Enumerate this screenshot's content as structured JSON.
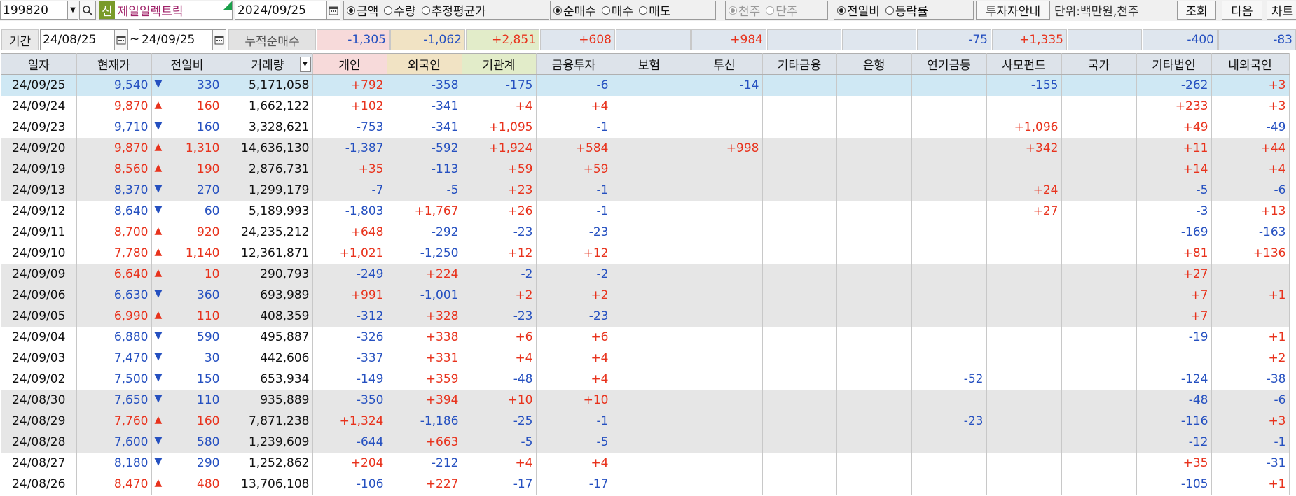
{
  "toolbar": {
    "code": "199820",
    "new_tag": "신",
    "company": "제일일렉트릭",
    "date": "2024/09/25",
    "radio_group1": [
      {
        "label": "금액",
        "on": true
      },
      {
        "label": "수량",
        "on": false
      },
      {
        "label": "추정평균가",
        "on": false
      }
    ],
    "radio_group2": [
      {
        "label": "순매수",
        "on": true
      },
      {
        "label": "매수",
        "on": false
      },
      {
        "label": "매도",
        "on": false
      }
    ],
    "radio_group3": [
      {
        "label": "천주",
        "on": true
      },
      {
        "label": "단주",
        "on": false
      }
    ],
    "radio_group4": [
      {
        "label": "전일비",
        "on": true
      },
      {
        "label": "등락률",
        "on": false
      }
    ],
    "investor_guide": "투자자안내",
    "unit": "단위:백만원,천주",
    "query": "조회",
    "next": "다음",
    "chart": "차트"
  },
  "period": {
    "label": "기간",
    "from": "24/08/25",
    "sep": "~",
    "to": "24/09/25",
    "cumulative_label": "누적순매수"
  },
  "summary": {
    "individual": "-1,305",
    "foreign": "-1,062",
    "institution": "+2,851",
    "finance": "+608",
    "insurance": "",
    "trust": "+984",
    "other_finance": "",
    "bank": "",
    "pension": "-75",
    "private_fund": "+1,335",
    "nation": "",
    "other_corp": "-400",
    "domestic_foreign": "-83"
  },
  "colors": {
    "up": "#e8321c",
    "down": "#2550c0",
    "header_bg": "#dde3ea",
    "selected_row": "#cfe8f4"
  },
  "columns": [
    "일자",
    "현재가",
    "전일비",
    "거래량",
    "개인",
    "외국인",
    "기관계",
    "금융투자",
    "보험",
    "투신",
    "기타금융",
    "은행",
    "연기금등",
    "사모펀드",
    "국가",
    "기타법인",
    "내외국인"
  ],
  "rows": [
    {
      "date": "24/09/25",
      "price": "9,540",
      "dir": "down",
      "chg": "330",
      "vol": "5,171,058",
      "ind": "+792",
      "frn": "-358",
      "inst": "-175",
      "fin": "-6",
      "ins": "",
      "trust": "-14",
      "ofin": "",
      "bank": "",
      "pen": "",
      "pf": "-155",
      "nat": "",
      "ocorp": "-262",
      "dfrn": "+3",
      "style": "sel"
    },
    {
      "date": "24/09/24",
      "price": "9,870",
      "dir": "up",
      "chg": "160",
      "vol": "1,662,122",
      "ind": "+102",
      "frn": "-341",
      "inst": "+4",
      "fin": "+4",
      "ins": "",
      "trust": "",
      "ofin": "",
      "bank": "",
      "pen": "",
      "pf": "",
      "nat": "",
      "ocorp": "+233",
      "dfrn": "+3",
      "style": ""
    },
    {
      "date": "24/09/23",
      "price": "9,710",
      "dir": "down",
      "chg": "160",
      "vol": "3,328,621",
      "ind": "-753",
      "frn": "-341",
      "inst": "+1,095",
      "fin": "-1",
      "ins": "",
      "trust": "",
      "ofin": "",
      "bank": "",
      "pen": "",
      "pf": "+1,096",
      "nat": "",
      "ocorp": "+49",
      "dfrn": "-49",
      "style": ""
    },
    {
      "date": "24/09/20",
      "price": "9,870",
      "dir": "up",
      "chg": "1,310",
      "vol": "14,636,130",
      "ind": "-1,387",
      "frn": "-592",
      "inst": "+1,924",
      "fin": "+584",
      "ins": "",
      "trust": "+998",
      "ofin": "",
      "bank": "",
      "pen": "",
      "pf": "+342",
      "nat": "",
      "ocorp": "+11",
      "dfrn": "+44",
      "style": "grey"
    },
    {
      "date": "24/09/19",
      "price": "8,560",
      "dir": "up",
      "chg": "190",
      "vol": "2,876,731",
      "ind": "+35",
      "frn": "-113",
      "inst": "+59",
      "fin": "+59",
      "ins": "",
      "trust": "",
      "ofin": "",
      "bank": "",
      "pen": "",
      "pf": "",
      "nat": "",
      "ocorp": "+14",
      "dfrn": "+4",
      "style": "grey"
    },
    {
      "date": "24/09/13",
      "price": "8,370",
      "dir": "down",
      "chg": "270",
      "vol": "1,299,179",
      "ind": "-7",
      "frn": "-5",
      "inst": "+23",
      "fin": "-1",
      "ins": "",
      "trust": "",
      "ofin": "",
      "bank": "",
      "pen": "",
      "pf": "+24",
      "nat": "",
      "ocorp": "-5",
      "dfrn": "-6",
      "style": "grey"
    },
    {
      "date": "24/09/12",
      "price": "8,640",
      "dir": "down",
      "chg": "60",
      "vol": "5,189,993",
      "ind": "-1,803",
      "frn": "+1,767",
      "inst": "+26",
      "fin": "-1",
      "ins": "",
      "trust": "",
      "ofin": "",
      "bank": "",
      "pen": "",
      "pf": "+27",
      "nat": "",
      "ocorp": "-3",
      "dfrn": "+13",
      "style": ""
    },
    {
      "date": "24/09/11",
      "price": "8,700",
      "dir": "up",
      "chg": "920",
      "vol": "24,235,212",
      "ind": "+648",
      "frn": "-292",
      "inst": "-23",
      "fin": "-23",
      "ins": "",
      "trust": "",
      "ofin": "",
      "bank": "",
      "pen": "",
      "pf": "",
      "nat": "",
      "ocorp": "-169",
      "dfrn": "-163",
      "style": ""
    },
    {
      "date": "24/09/10",
      "price": "7,780",
      "dir": "up",
      "chg": "1,140",
      "vol": "12,361,871",
      "ind": "+1,021",
      "frn": "-1,250",
      "inst": "+12",
      "fin": "+12",
      "ins": "",
      "trust": "",
      "ofin": "",
      "bank": "",
      "pen": "",
      "pf": "",
      "nat": "",
      "ocorp": "+81",
      "dfrn": "+136",
      "style": ""
    },
    {
      "date": "24/09/09",
      "price": "6,640",
      "dir": "up",
      "chg": "10",
      "vol": "290,793",
      "ind": "-249",
      "frn": "+224",
      "inst": "-2",
      "fin": "-2",
      "ins": "",
      "trust": "",
      "ofin": "",
      "bank": "",
      "pen": "",
      "pf": "",
      "nat": "",
      "ocorp": "+27",
      "dfrn": "",
      "style": "grey"
    },
    {
      "date": "24/09/06",
      "price": "6,630",
      "dir": "down",
      "chg": "360",
      "vol": "693,989",
      "ind": "+991",
      "frn": "-1,001",
      "inst": "+2",
      "fin": "+2",
      "ins": "",
      "trust": "",
      "ofin": "",
      "bank": "",
      "pen": "",
      "pf": "",
      "nat": "",
      "ocorp": "+7",
      "dfrn": "+1",
      "style": "grey"
    },
    {
      "date": "24/09/05",
      "price": "6,990",
      "dir": "up",
      "chg": "110",
      "vol": "408,359",
      "ind": "-312",
      "frn": "+328",
      "inst": "-23",
      "fin": "-23",
      "ins": "",
      "trust": "",
      "ofin": "",
      "bank": "",
      "pen": "",
      "pf": "",
      "nat": "",
      "ocorp": "+7",
      "dfrn": "",
      "style": "grey"
    },
    {
      "date": "24/09/04",
      "price": "6,880",
      "dir": "down",
      "chg": "590",
      "vol": "495,887",
      "ind": "-326",
      "frn": "+338",
      "inst": "+6",
      "fin": "+6",
      "ins": "",
      "trust": "",
      "ofin": "",
      "bank": "",
      "pen": "",
      "pf": "",
      "nat": "",
      "ocorp": "-19",
      "dfrn": "+1",
      "style": ""
    },
    {
      "date": "24/09/03",
      "price": "7,470",
      "dir": "down",
      "chg": "30",
      "vol": "442,606",
      "ind": "-337",
      "frn": "+331",
      "inst": "+4",
      "fin": "+4",
      "ins": "",
      "trust": "",
      "ofin": "",
      "bank": "",
      "pen": "",
      "pf": "",
      "nat": "",
      "ocorp": "",
      "dfrn": "+2",
      "style": ""
    },
    {
      "date": "24/09/02",
      "price": "7,500",
      "dir": "down",
      "chg": "150",
      "vol": "653,934",
      "ind": "-149",
      "frn": "+359",
      "inst": "-48",
      "fin": "+4",
      "ins": "",
      "trust": "",
      "ofin": "",
      "bank": "",
      "pen": "-52",
      "pf": "",
      "nat": "",
      "ocorp": "-124",
      "dfrn": "-38",
      "style": ""
    },
    {
      "date": "24/08/30",
      "price": "7,650",
      "dir": "down",
      "chg": "110",
      "vol": "935,889",
      "ind": "-350",
      "frn": "+394",
      "inst": "+10",
      "fin": "+10",
      "ins": "",
      "trust": "",
      "ofin": "",
      "bank": "",
      "pen": "",
      "pf": "",
      "nat": "",
      "ocorp": "-48",
      "dfrn": "-6",
      "style": "grey"
    },
    {
      "date": "24/08/29",
      "price": "7,760",
      "dir": "up",
      "chg": "160",
      "vol": "7,871,238",
      "ind": "+1,324",
      "frn": "-1,186",
      "inst": "-25",
      "fin": "-1",
      "ins": "",
      "trust": "",
      "ofin": "",
      "bank": "",
      "pen": "-23",
      "pf": "",
      "nat": "",
      "ocorp": "-116",
      "dfrn": "+3",
      "style": "grey"
    },
    {
      "date": "24/08/28",
      "price": "7,600",
      "dir": "down",
      "chg": "580",
      "vol": "1,239,609",
      "ind": "-644",
      "frn": "+663",
      "inst": "-5",
      "fin": "-5",
      "ins": "",
      "trust": "",
      "ofin": "",
      "bank": "",
      "pen": "",
      "pf": "",
      "nat": "",
      "ocorp": "-12",
      "dfrn": "-1",
      "style": "grey"
    },
    {
      "date": "24/08/27",
      "price": "8,180",
      "dir": "down",
      "chg": "290",
      "vol": "1,252,862",
      "ind": "+204",
      "frn": "-212",
      "inst": "+4",
      "fin": "+4",
      "ins": "",
      "trust": "",
      "ofin": "",
      "bank": "",
      "pen": "",
      "pf": "",
      "nat": "",
      "ocorp": "+35",
      "dfrn": "-31",
      "style": ""
    },
    {
      "date": "24/08/26",
      "price": "8,470",
      "dir": "up",
      "chg": "480",
      "vol": "13,706,108",
      "ind": "-106",
      "frn": "+227",
      "inst": "-17",
      "fin": "-17",
      "ins": "",
      "trust": "",
      "ofin": "",
      "bank": "",
      "pen": "",
      "pf": "",
      "nat": "",
      "ocorp": "-105",
      "dfrn": "+1",
      "style": ""
    }
  ]
}
